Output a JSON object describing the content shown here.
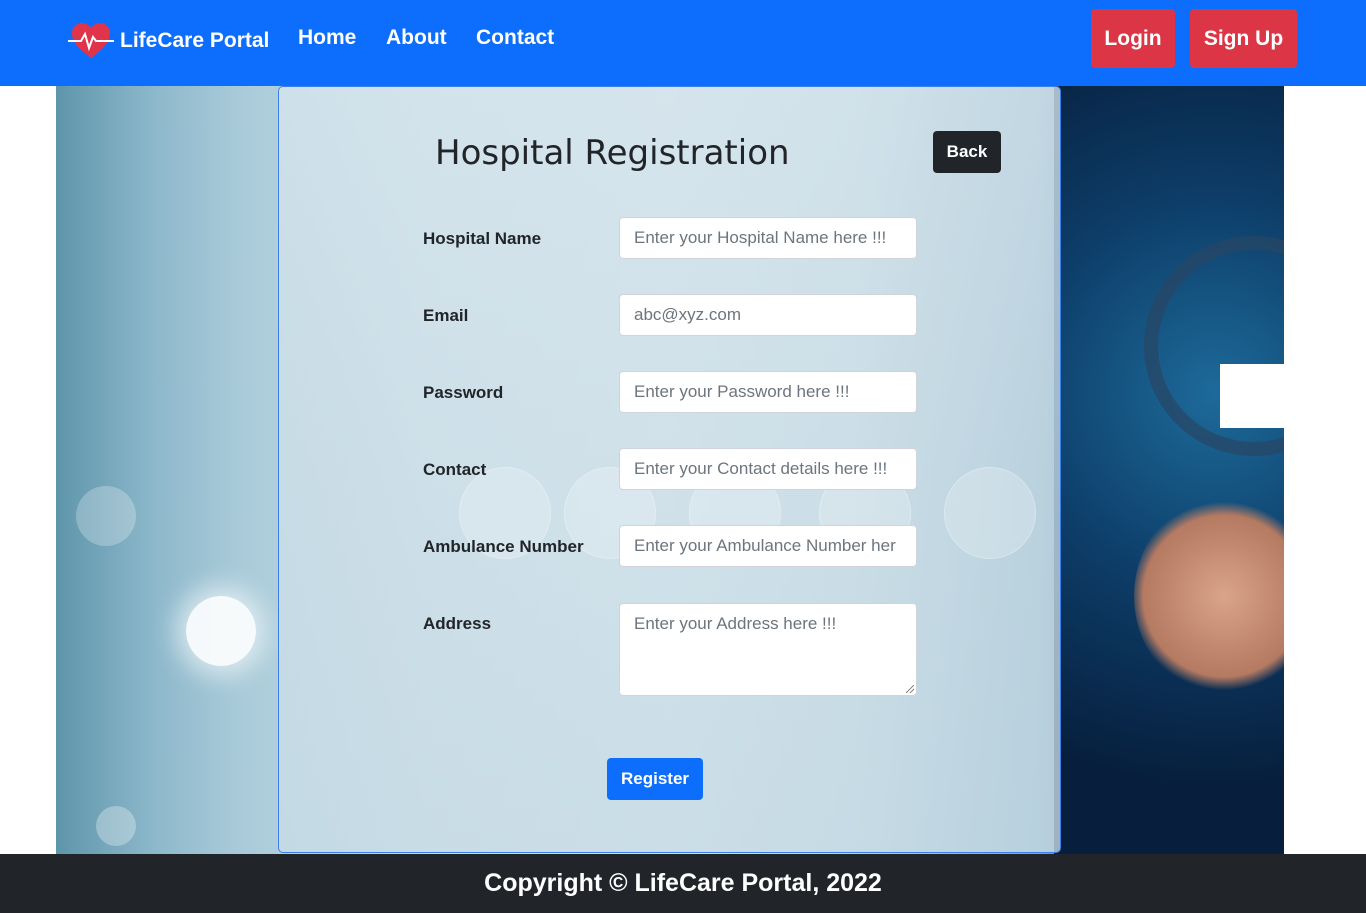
{
  "navbar": {
    "brand": "LifeCare Portal",
    "links": [
      "Home",
      "About",
      "Contact"
    ],
    "login_label": "Login",
    "signup_label": "Sign Up",
    "color": "#0d6efd"
  },
  "form": {
    "title": "Hospital Registration",
    "back_label": "Back",
    "fields": [
      {
        "label": "Hospital Name",
        "placeholder": "Enter your Hospital Name here !!!"
      },
      {
        "label": "Email",
        "placeholder": "abc@xyz.com"
      },
      {
        "label": "Password",
        "placeholder": "Enter your Password here !!!"
      },
      {
        "label": "Contact",
        "placeholder": "Enter your Contact details here !!!"
      },
      {
        "label": "Ambulance Number",
        "placeholder": "Enter your Ambulance Number her"
      },
      {
        "label": "Address",
        "placeholder": "Enter your Address here !!!"
      }
    ],
    "register_label": "Register"
  },
  "footer": {
    "text": "Copyright © LifeCare Portal, 2022"
  },
  "colors": {
    "accent": "#0d6efd",
    "danger": "#dc3545",
    "dark": "#212529"
  },
  "icons": {
    "brand": "heart-pulse-icon"
  }
}
